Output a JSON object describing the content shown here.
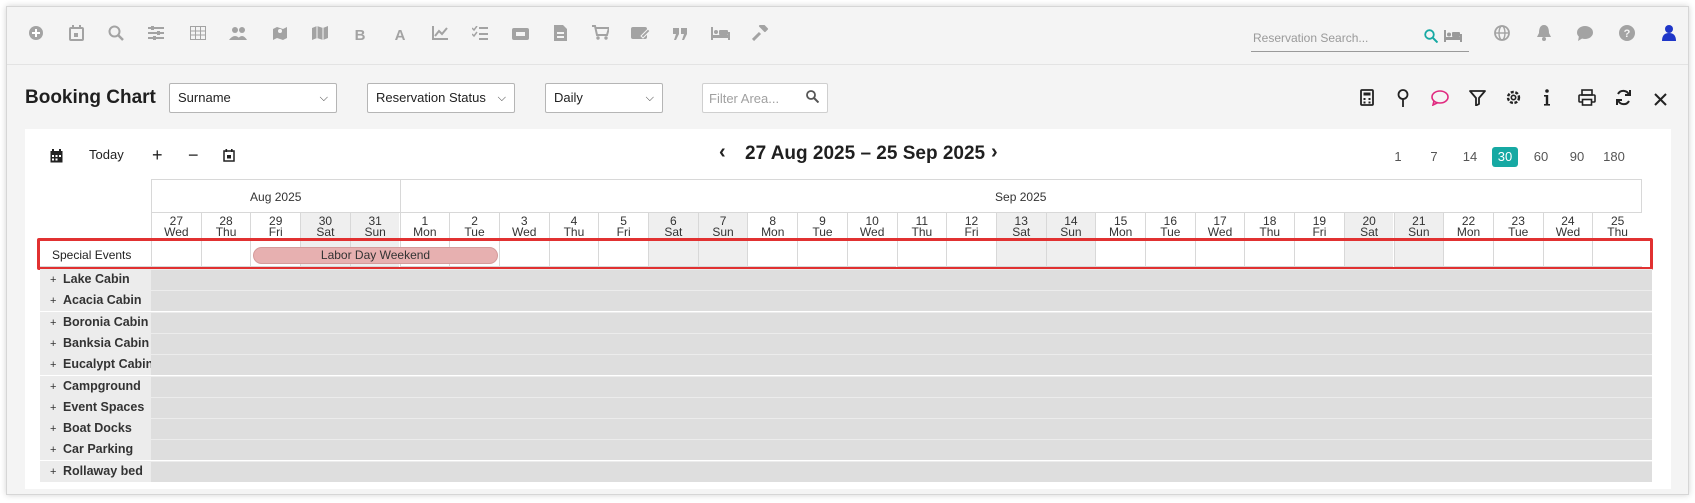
{
  "topnav": {
    "icons": [
      "plus-circle-icon",
      "calendar-icon",
      "search-icon",
      "sliders-icon",
      "grid-table-icon",
      "users-icon",
      "map-pin-icon",
      "map-icon",
      "bold-icon",
      "font-icon",
      "line-chart-icon",
      "checklist-icon",
      "money-icon",
      "document-icon",
      "cart-icon",
      "cash-card-icon",
      "quote-icon",
      "bed-icon",
      "gavel-icon"
    ],
    "bold_letter": "B",
    "font_letter": "A",
    "search_placeholder": "Reservation Search...",
    "right_icons": [
      "globe-icon",
      "bell-icon",
      "chat-icon",
      "help-icon",
      "user-icon"
    ]
  },
  "header": {
    "title": "Booking Chart",
    "sort_select": "Surname",
    "status_select": "Reservation Status",
    "period_select": "Daily",
    "filter_placeholder": "Filter Area..."
  },
  "chart": {
    "today_label": "Today",
    "plus_label": "+",
    "minus_label": "−",
    "date_range": "27 Aug 2025 – 25 Sep 2025",
    "zoom_options": [
      "1",
      "7",
      "14",
      "30",
      "60",
      "90",
      "180"
    ],
    "zoom_active": "30",
    "months": [
      {
        "label": "Aug 2025",
        "days": 5
      },
      {
        "label": "Sep 2025",
        "days": 25
      }
    ],
    "days": [
      {
        "num": "27",
        "dow": "Wed",
        "weekend": false
      },
      {
        "num": "28",
        "dow": "Thu",
        "weekend": false
      },
      {
        "num": "29",
        "dow": "Fri",
        "weekend": false
      },
      {
        "num": "30",
        "dow": "Sat",
        "weekend": true
      },
      {
        "num": "31",
        "dow": "Sun",
        "weekend": true
      },
      {
        "num": "1",
        "dow": "Mon",
        "weekend": false
      },
      {
        "num": "2",
        "dow": "Tue",
        "weekend": false
      },
      {
        "num": "3",
        "dow": "Wed",
        "weekend": false
      },
      {
        "num": "4",
        "dow": "Thu",
        "weekend": false
      },
      {
        "num": "5",
        "dow": "Fri",
        "weekend": false
      },
      {
        "num": "6",
        "dow": "Sat",
        "weekend": true
      },
      {
        "num": "7",
        "dow": "Sun",
        "weekend": true
      },
      {
        "num": "8",
        "dow": "Mon",
        "weekend": false
      },
      {
        "num": "9",
        "dow": "Tue",
        "weekend": false
      },
      {
        "num": "10",
        "dow": "Wed",
        "weekend": false
      },
      {
        "num": "11",
        "dow": "Thu",
        "weekend": false
      },
      {
        "num": "12",
        "dow": "Fri",
        "weekend": false
      },
      {
        "num": "13",
        "dow": "Sat",
        "weekend": true
      },
      {
        "num": "14",
        "dow": "Sun",
        "weekend": true
      },
      {
        "num": "15",
        "dow": "Mon",
        "weekend": false
      },
      {
        "num": "16",
        "dow": "Tue",
        "weekend": false
      },
      {
        "num": "17",
        "dow": "Wed",
        "weekend": false
      },
      {
        "num": "18",
        "dow": "Thu",
        "weekend": false
      },
      {
        "num": "19",
        "dow": "Fri",
        "weekend": false
      },
      {
        "num": "20",
        "dow": "Sat",
        "weekend": true
      },
      {
        "num": "21",
        "dow": "Sun",
        "weekend": true
      },
      {
        "num": "22",
        "dow": "Mon",
        "weekend": false
      },
      {
        "num": "23",
        "dow": "Tue",
        "weekend": false
      },
      {
        "num": "24",
        "dow": "Wed",
        "weekend": false
      },
      {
        "num": "25",
        "dow": "Thu",
        "weekend": false
      }
    ],
    "special_events_label": "Special Events",
    "event": {
      "label": "Labor Day Weekend",
      "start": "29 Aug",
      "end": "2 Sep"
    },
    "areas": [
      "Lake Cabin",
      "Acacia Cabin",
      "Boronia Cabin",
      "Banksia Cabin",
      "Eucalypt Cabin",
      "Campground",
      "Event Spaces",
      "Boat Docks",
      "Car Parking",
      "Rollaway bed"
    ],
    "expand_symbol": "+"
  },
  "colors": {
    "accent": "#16a9a3",
    "event_bar": "#e7b0b0",
    "highlight": "#e13131",
    "user_icon": "#1f36c8",
    "chat_icon": "#e0297f"
  }
}
